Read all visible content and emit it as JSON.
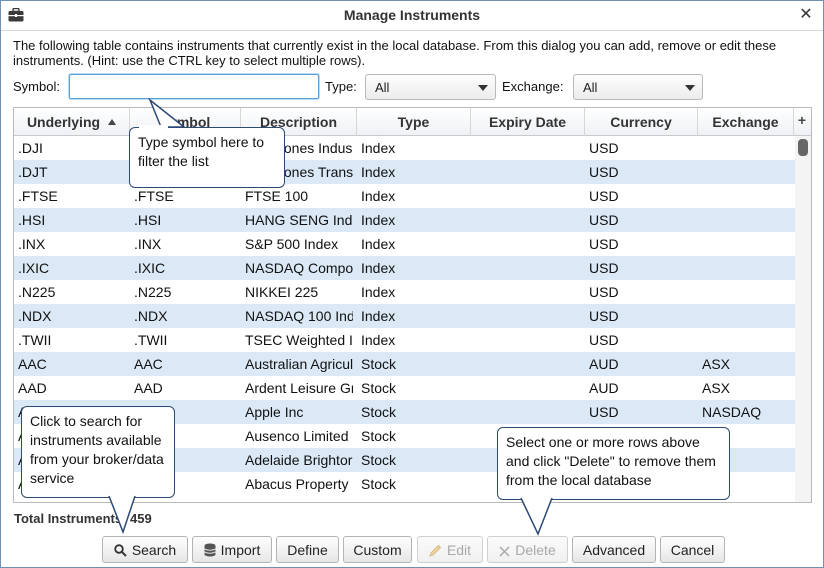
{
  "window": {
    "title": "Manage Instruments"
  },
  "intro_text": "The following table contains instruments that currently exist in the local database.  From this dialog you can add, remove or edit these instruments. (Hint: use the CTRL key to select multiple rows).",
  "filters": {
    "symbol_label": "Symbol:",
    "symbol_value": "",
    "type_label": "Type:",
    "type_value": "All",
    "exchange_label": "Exchange:",
    "exchange_value": "All"
  },
  "table": {
    "columns": [
      "Underlying",
      "Symbol",
      "Description",
      "Type",
      "Expiry Date",
      "Currency",
      "Exchange"
    ],
    "sort_column": "Underlying",
    "rows": [
      [
        ".DJI",
        "",
        "Dow Jones Indus",
        "Index",
        "",
        "USD",
        ""
      ],
      [
        ".DJT",
        "",
        "Dow Jones Trans",
        "Index",
        "",
        "USD",
        ""
      ],
      [
        ".FTSE",
        ".FTSE",
        "FTSE 100",
        "Index",
        "",
        "USD",
        ""
      ],
      [
        ".HSI",
        ".HSI",
        "HANG SENG Ind",
        "Index",
        "",
        "USD",
        ""
      ],
      [
        ".INX",
        ".INX",
        "S&P 500 Index",
        "Index",
        "",
        "USD",
        ""
      ],
      [
        ".IXIC",
        ".IXIC",
        "NASDAQ Compo",
        "Index",
        "",
        "USD",
        ""
      ],
      [
        ".N225",
        ".N225",
        "NIKKEI 225",
        "Index",
        "",
        "USD",
        ""
      ],
      [
        ".NDX",
        ".NDX",
        "NASDAQ 100 Ind",
        "Index",
        "",
        "USD",
        ""
      ],
      [
        ".TWII",
        ".TWII",
        "TSEC Weighted I",
        "Index",
        "",
        "USD",
        ""
      ],
      [
        "AAC",
        "AAC",
        "Australian Agricul",
        "Stock",
        "",
        "AUD",
        "ASX"
      ],
      [
        "AAD",
        "AAD",
        "Ardent Leisure Gr",
        "Stock",
        "",
        "AUD",
        "ASX"
      ],
      [
        "A",
        "",
        "Apple Inc",
        "Stock",
        "",
        "USD",
        "NASDAQ"
      ],
      [
        "A",
        "",
        "Ausenco Limited",
        "Stock",
        "",
        "",
        ""
      ],
      [
        "A",
        "",
        "Adelaide Brightor",
        "Stock",
        "",
        "",
        ""
      ],
      [
        "A",
        "",
        "Abacus Property",
        "Stock",
        "",
        "",
        ""
      ]
    ]
  },
  "footer": {
    "total_label": "Total Instruments: 459"
  },
  "buttons": {
    "search": "Search",
    "import": "Import",
    "define": "Define",
    "custom": "Custom",
    "edit": "Edit",
    "delete": "Delete",
    "advanced": "Advanced",
    "cancel": "Cancel"
  },
  "callouts": {
    "symbol_hint": "Type symbol here to filter the list",
    "search_hint": "Click to search for instruments available from your broker/data service",
    "delete_hint": "Select one or more rows above and click \"Delete\" to remove them from the local database"
  },
  "colors": {
    "row_alt": "#dbe9f7",
    "callout_border": "#2c4a73",
    "input_focus": "#5aa0d6"
  },
  "icons": {
    "app": "briefcase-icon",
    "close": "close-icon",
    "search": "magnifier-icon",
    "import": "database-icon",
    "edit": "pencil-icon",
    "delete": "x-icon",
    "add_column": "plus-icon"
  }
}
